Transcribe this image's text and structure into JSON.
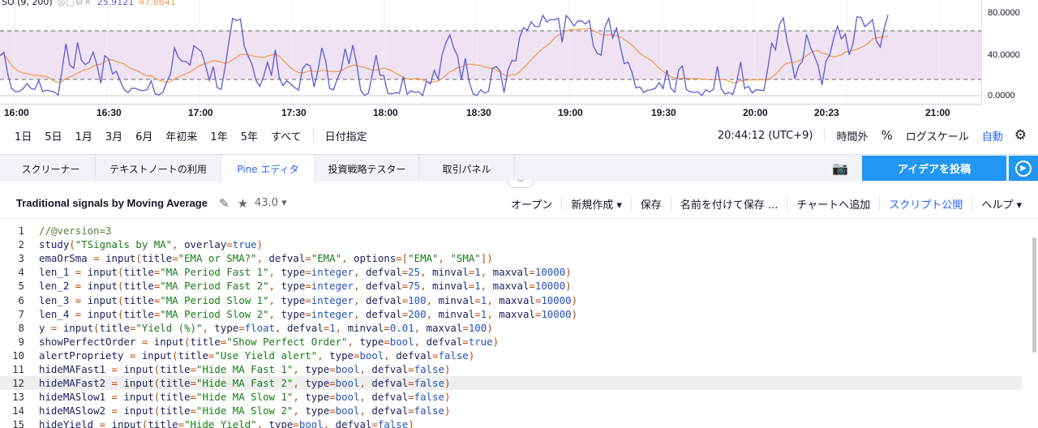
{
  "chart": {
    "indicator_label": "SO (9, 200)",
    "indicator_value1": "25.9121",
    "indicator_value2": "47.8641",
    "y_axis": {
      "ticks": [
        "80.0000",
        "40.0000",
        "0.0000"
      ],
      "range": [
        0,
        100
      ],
      "upper_band": 80,
      "lower_band": 20
    },
    "x_axis": {
      "ticks": [
        "16:00",
        "16:30",
        "17:00",
        "17:30",
        "18:00",
        "18:30",
        "19:00",
        "19:30",
        "20:00",
        "20:23",
        "21:00"
      ]
    },
    "colors": {
      "k_line": "#5b5bd6",
      "d_line": "#f2994a",
      "band": "#efe2f2"
    }
  },
  "range_bar": {
    "ranges": [
      "1日",
      "5日",
      "1月",
      "3月",
      "6月",
      "年初来",
      "1年",
      "5年",
      "すべて"
    ],
    "date_picker": "日付指定",
    "time": "20:44:12 (UTC+9)",
    "extended_hours": "時間外",
    "percent": "%",
    "log_scale": "ログスケール",
    "auto": "自動",
    "settings_icon": "gear-icon"
  },
  "tabs": {
    "items": [
      "スクリーナー",
      "テキストノートの利用",
      "Pine エディタ",
      "投資戦略テスター",
      "取引パネル"
    ],
    "active": "Pine エディタ",
    "post_idea": "アイデアを投稿",
    "camera_icon": "camera-icon",
    "play_icon": "play-icon"
  },
  "editor": {
    "script_name": "Traditional signals by Moving Average",
    "version": "43.0 ▾",
    "menu": {
      "open": "オープン",
      "new": "新規作成 ▾",
      "save": "保存",
      "save_as": "名前を付けて保存 ...",
      "add_to_chart": "チャートへ追加",
      "publish": "スクリプト公開",
      "help": "ヘルプ ▾"
    },
    "highlighted_line": 12,
    "lines": [
      "//@version=3",
      "study(\"TSignals by MA\", overlay=true)",
      "emaOrSma = input(title=\"EMA or SMA?\", defval=\"EMA\", options=[\"EMA\", \"SMA\"])",
      "len_1 = input(title=\"MA Period Fast 1\", type=integer, defval=25, minval=1, maxval=10000)",
      "len_2 = input(title=\"MA Period Fast 2\", type=integer, defval=75, minval=1, maxval=10000)",
      "len_3 = input(title=\"MA Period Slow 1\", type=integer, defval=100, minval=1, maxval=10000)",
      "len_4 = input(title=\"MA Period Slow 2\", type=integer, defval=200, minval=1, maxval=10000)",
      "y = input(title=\"Yield (%)\", type=float, defval=1, minval=0.01, maxval=100)",
      "showPerfectOrder = input(title=\"Show Perfect Order\", type=bool, defval=true)",
      "alertPropriety = input(title=\"Use Yield alert\", type=bool, defval=false)",
      "hideMAFast1 = input(title=\"Hide MA Fast 1\", type=bool, defval=false)",
      "hideMAFast2 = input(title=\"Hide MA Fast 2\", type=bool, defval=false)",
      "hideMASlow1 = input(title=\"Hide MA Slow 1\", type=bool, defval=false)",
      "hideMASlow2 = input(title=\"Hide MA Slow 2\", type=bool, defval=false)",
      "hideYield = input(title=\"Hide Yield\", type=bool, defval=false)"
    ]
  }
}
